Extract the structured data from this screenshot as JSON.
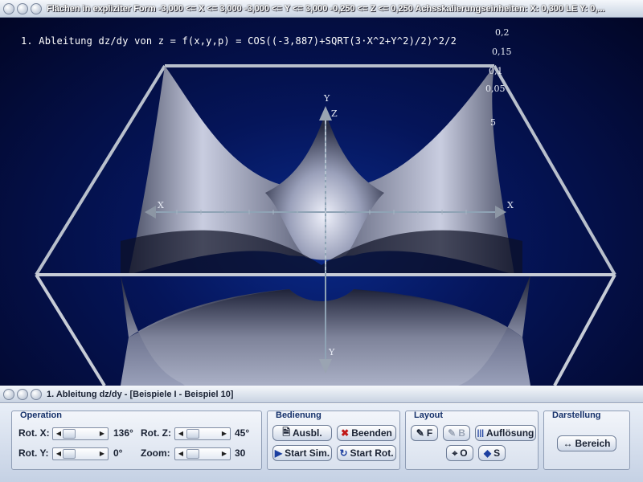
{
  "window": {
    "title": "Flächen in expliziter Form   -3,000 <= X <= 3,000   -3,000 <= Y <= 3,000   -0,250 <= Z <= 0,250   Achsskalierungseinheiten:  X: 0,300 LE   Y: 0,..."
  },
  "plot": {
    "formula": "1. Ableitung dz/dy von z = f(x,y,p) = COS((-3,887)+SQRT(3·X^2+Y^2)/2)^2/2",
    "z_ticks": [
      "0,2",
      "0,15",
      "0,1",
      "0,05",
      "5"
    ],
    "axis_labels": {
      "x_left": "X",
      "x_right": "X",
      "y_top": "Y",
      "z_top": "Z",
      "y_bottom": "Y"
    }
  },
  "subwindow": {
    "title": "1. Ableitung dz/dy - [Beispiele I - Beispiel 10]"
  },
  "panel": {
    "operation": {
      "title": "Operation",
      "rot_x_label": "Rot. X:",
      "rot_x_value": "136°",
      "rot_y_label": "Rot. Y:",
      "rot_y_value": "0°",
      "rot_z_label": "Rot. Z:",
      "rot_z_value": "45°",
      "zoom_label": "Zoom:",
      "zoom_value": "30"
    },
    "bedienung": {
      "title": "Bedienung",
      "ausbl": "Ausbl.",
      "beenden": "Beenden",
      "start_sim": "Start Sim.",
      "start_rot": "Start Rot."
    },
    "layout": {
      "title": "Layout",
      "f": "F",
      "b": "B",
      "aufloesung": "Auflösung",
      "o": "O",
      "s": "S"
    },
    "darstellung": {
      "title": "Darstellung",
      "bereich": "Bereich"
    }
  }
}
